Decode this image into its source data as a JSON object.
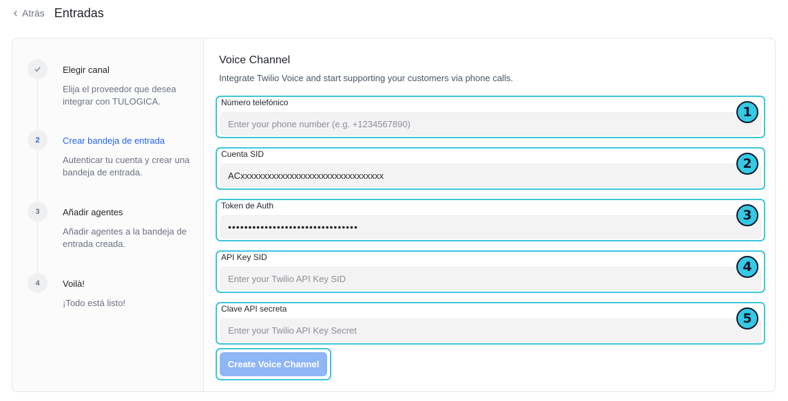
{
  "header": {
    "back_label": "Atrás",
    "title": "Entradas"
  },
  "steps": [
    {
      "number": "",
      "status": "done",
      "title": "Elegir canal",
      "description": "Elija el proveedor que desea integrar con TULOGICA."
    },
    {
      "number": "2",
      "status": "active",
      "title": "Crear bandeja de entrada",
      "description": "Autenticar tu cuenta y crear una bandeja de entrada."
    },
    {
      "number": "3",
      "status": "pending",
      "title": "Añadir agentes",
      "description": "Añadir agentes a la bandeja de entrada creada."
    },
    {
      "number": "4",
      "status": "pending",
      "title": "Voilà!",
      "description": "¡Todo está listo!"
    }
  ],
  "form": {
    "title": "Voice Channel",
    "subtitle": "Integrate Twilio Voice and start supporting your customers via phone calls.",
    "fields": [
      {
        "badge": "1",
        "label": "Número telefónico",
        "value": "",
        "placeholder": "Enter your phone number (e.g. +1234567890)"
      },
      {
        "badge": "2",
        "label": "Cuenta SID",
        "value": "ACxxxxxxxxxxxxxxxxxxxxxxxxxxxxxxxx",
        "placeholder": ""
      },
      {
        "badge": "3",
        "label": "Token de Auth",
        "value": "••••••••••••••••••••••••••••••••",
        "placeholder": ""
      },
      {
        "badge": "4",
        "label": "API Key SID",
        "value": "",
        "placeholder": "Enter your Twilio API Key SID"
      },
      {
        "badge": "5",
        "label": "Clave API secreta",
        "value": "",
        "placeholder": "Enter your Twilio API Key Secret"
      }
    ],
    "submit_label": "Create Voice Channel"
  },
  "colors": {
    "accent": "#2463eb",
    "highlight": "#3cc6dc",
    "badge": "#35c9e3",
    "button": "#8fb6f5"
  }
}
